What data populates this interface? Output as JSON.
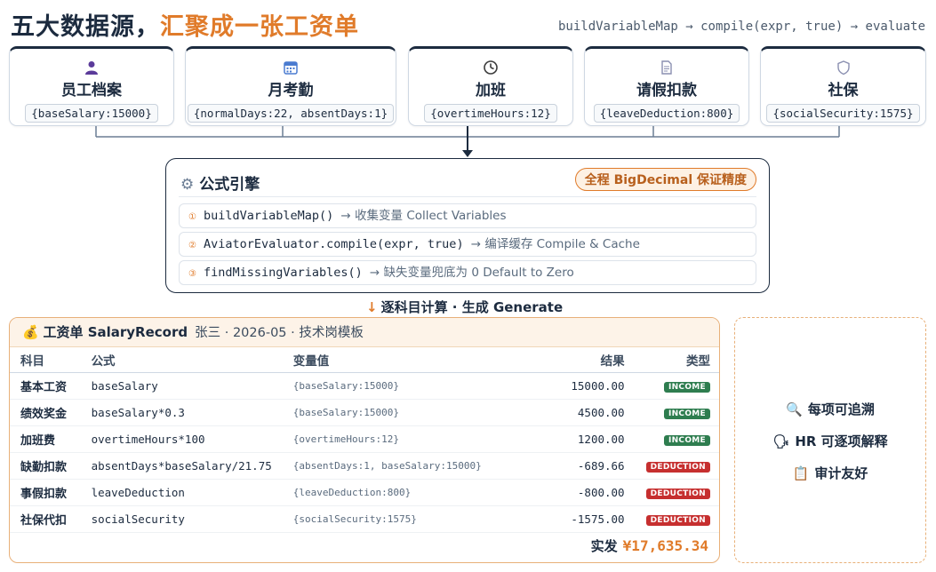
{
  "title": {
    "main": "五大数据源，",
    "accent": "汇聚成一张工资单"
  },
  "pipeline": "buildVariableMap → compile(expr, true) → evaluate",
  "sources": [
    {
      "icon": "person-icon",
      "name": "员工档案",
      "var": "{baseSalary:15000}"
    },
    {
      "icon": "calendar-icon",
      "name": "月考勤",
      "var": "{normalDays:22, absentDays:1}"
    },
    {
      "icon": "clock-icon",
      "name": "加班",
      "var": "{overtimeHours:12}"
    },
    {
      "icon": "document-icon",
      "name": "请假扣款",
      "var": "{leaveDeduction:800}"
    },
    {
      "icon": "shield-icon",
      "name": "社保",
      "var": "{socialSecurity:1575}"
    }
  ],
  "engine": {
    "title": "公式引擎",
    "badge": "全程 BigDecimal 保证精度",
    "steps": [
      {
        "num": "①",
        "code": "buildVariableMap()",
        "desc": "→ 收集变量 Collect Variables"
      },
      {
        "num": "②",
        "code": "AviatorEvaluator.compile(expr, true)",
        "desc": "→ 编译缓存 Compile & Cache"
      },
      {
        "num": "③",
        "code": "findMissingVariables()",
        "desc": "→ 缺失变量兜底为 0 Default to Zero"
      }
    ]
  },
  "generate": {
    "arrow": "↓",
    "label": "逐科目计算 · 生成 Generate"
  },
  "salary": {
    "title": "工资单 SalaryRecord",
    "meta": "张三 · 2026-05 · 技术岗模板",
    "headers": {
      "item": "科目",
      "formula": "公式",
      "vars": "变量值",
      "result": "结果",
      "type": "类型"
    },
    "rows": [
      {
        "item": "基本工资",
        "formula": "baseSalary",
        "vars": "{baseSalary:15000}",
        "result": "15000.00",
        "type": "INCOME"
      },
      {
        "item": "绩效奖金",
        "formula": "baseSalary*0.3",
        "vars": "{baseSalary:15000}",
        "result": "4500.00",
        "type": "INCOME"
      },
      {
        "item": "加班费",
        "formula": "overtimeHours*100",
        "vars": "{overtimeHours:12}",
        "result": "1200.00",
        "type": "INCOME"
      },
      {
        "item": "缺勤扣款",
        "formula": "absentDays*baseSalary/21.75",
        "vars": "{absentDays:1, baseSalary:15000}",
        "result": "-689.66",
        "type": "DEDUCTION"
      },
      {
        "item": "事假扣款",
        "formula": "leaveDeduction",
        "vars": "{leaveDeduction:800}",
        "result": "-800.00",
        "type": "DEDUCTION"
      },
      {
        "item": "社保代扣",
        "formula": "socialSecurity",
        "vars": "{socialSecurity:1575}",
        "result": "-1575.00",
        "type": "DEDUCTION"
      }
    ],
    "total_label": "实发",
    "total_value": "¥17,635.34"
  },
  "notes": [
    {
      "icon": "magnifier-icon",
      "glyph": "🔍",
      "text": "每项可追溯"
    },
    {
      "icon": "speaking-head-icon",
      "glyph": "🗣",
      "text": "HR 可逐项解释"
    },
    {
      "icon": "clipboard-icon",
      "glyph": "📋",
      "text": "审计友好"
    }
  ],
  "colors": {
    "navy": "#1c2b3f",
    "accent": "#e07b2a",
    "income": "#2e7d4f",
    "deduction": "#c62f2f"
  }
}
